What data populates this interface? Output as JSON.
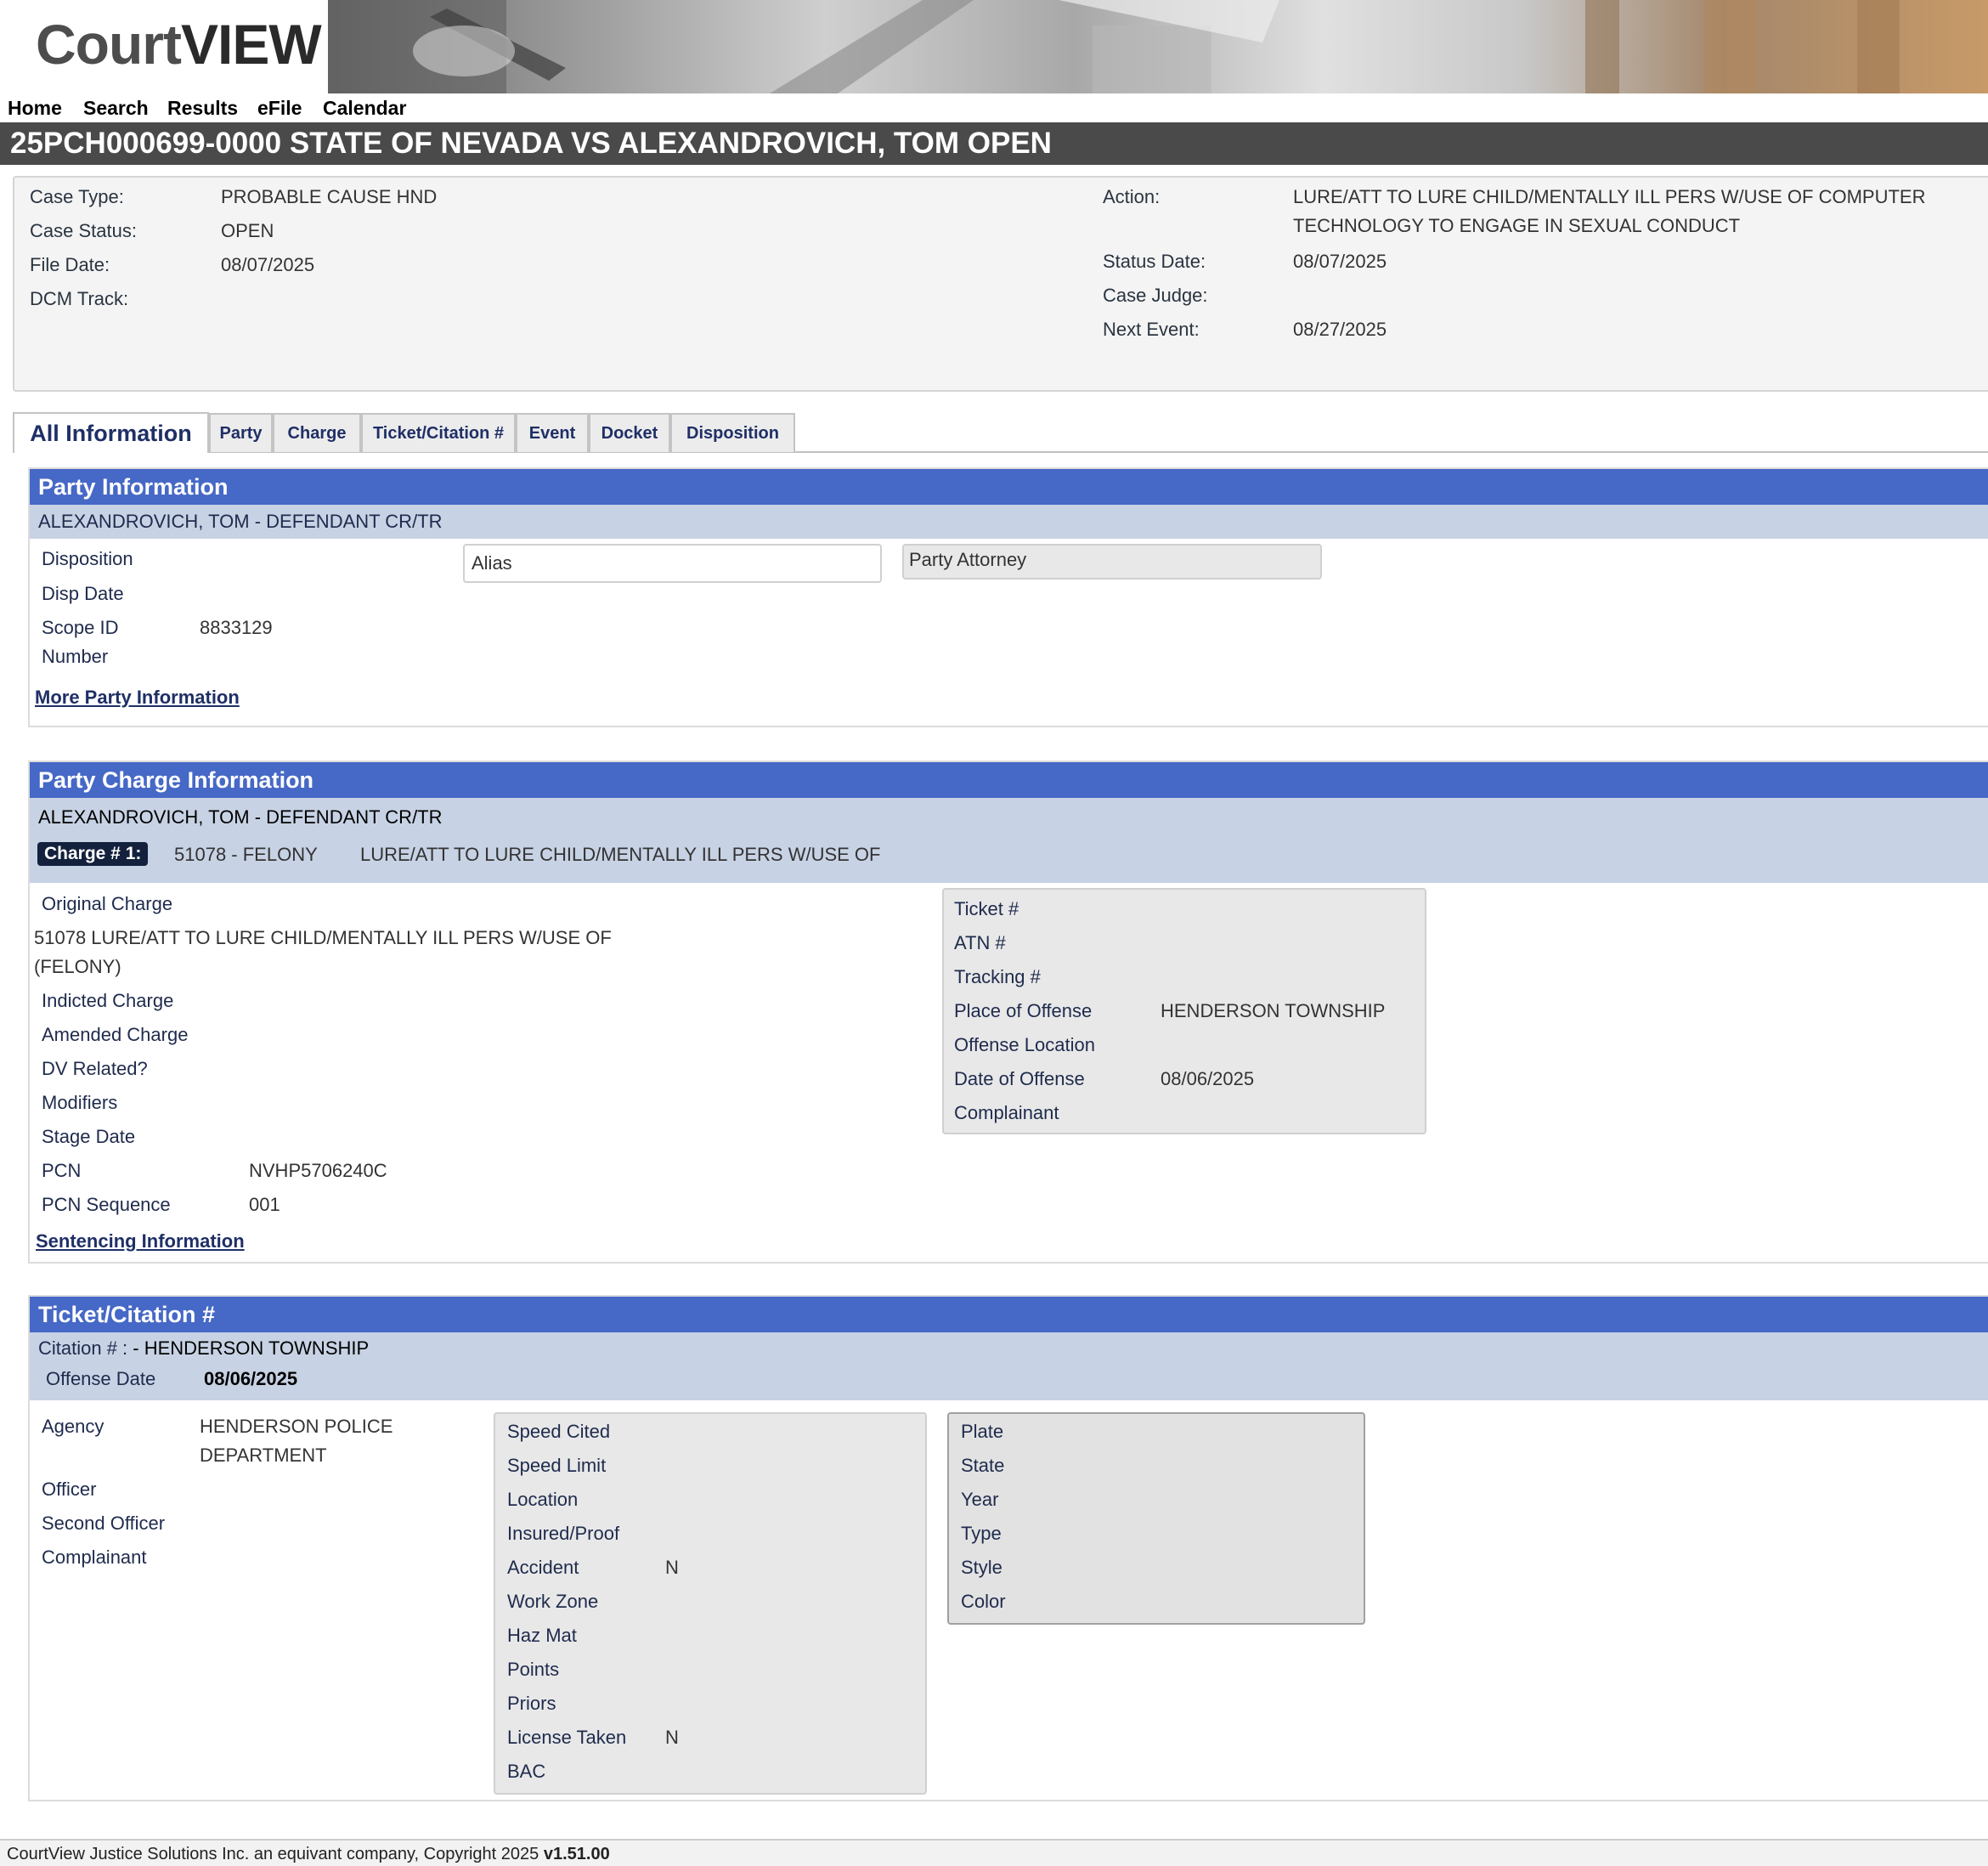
{
  "app": {
    "logo_court": "Court",
    "logo_view": "VIEW"
  },
  "nav": {
    "home": "Home",
    "search": "Search",
    "results": "Results",
    "efile": "eFile",
    "calendar": "Calendar"
  },
  "case": {
    "title": "25PCH000699-0000 STATE OF NEVADA VS ALEXANDROVICH, TOM OPEN"
  },
  "summary": {
    "case_type_label": "Case Type:",
    "case_type": "PROBABLE CAUSE HND",
    "case_status_label": "Case Status:",
    "case_status": "OPEN",
    "file_date_label": "File Date:",
    "file_date": "08/07/2025",
    "dcm_track_label": "DCM Track:",
    "action_label": "Action:",
    "action_line1": "LURE/ATT TO LURE CHILD/MENTALLY ILL PERS W/USE OF COMPUTER",
    "action_line2": "TECHNOLOGY TO ENGAGE IN SEXUAL CONDUCT",
    "status_date_label": "Status Date:",
    "status_date": "08/07/2025",
    "case_judge_label": "Case Judge:",
    "next_event_label": "Next Event:",
    "next_event": "08/27/2025"
  },
  "tabs": {
    "all": "All Information",
    "party": "Party",
    "charge": "Charge",
    "ticket": "Ticket/Citation #",
    "event": "Event",
    "docket": "Docket",
    "disposition": "Disposition"
  },
  "party_info": {
    "heading": "Party Information",
    "party_name": "ALEXANDROVICH, TOM",
    "party_role": " - DEFENDANT CR/TR",
    "disposition_label": "Disposition",
    "disp_date_label": "Disp Date",
    "scope_id_label_1": "Scope ID",
    "scope_id_label_2": "Number",
    "scope_id": "8833129",
    "alias_label": "Alias",
    "attorney_label": "Party Attorney",
    "more_link": "More Party Information"
  },
  "charge_info": {
    "heading": "Party Charge Information",
    "party_name": "ALEXANDROVICH, TOM",
    "party_role": " - DEFENDANT CR/TR",
    "charge_badge": "Charge # 1:",
    "charge_code": "51078 - FELONY",
    "charge_desc": "LURE/ATT TO LURE CHILD/MENTALLY ILL PERS W/USE OF",
    "original_charge_label": "Original Charge",
    "original_charge_line1": "51078 LURE/ATT TO LURE CHILD/MENTALLY ILL PERS W/USE OF",
    "original_charge_line2": "(FELONY)",
    "indicted_label": "Indicted Charge",
    "amended_label": "Amended Charge",
    "dv_label": "DV Related?",
    "modifiers_label": "Modifiers",
    "stage_date_label": "Stage Date",
    "pcn_label": "PCN",
    "pcn": "NVHP5706240C",
    "pcn_seq_label": "PCN Sequence",
    "pcn_seq": "001",
    "sentencing_link": "Sentencing Information",
    "ticket_label": "Ticket #",
    "atn_label": "ATN #",
    "tracking_label": "Tracking #",
    "place_label": "Place of Offense",
    "place": "HENDERSON TOWNSHIP",
    "location_label": "Offense Location",
    "date_label": "Date of Offense",
    "date": "08/06/2025",
    "complainant_label": "Complainant"
  },
  "citation": {
    "heading": "Ticket/Citation #",
    "citation_label": "Citation # : ",
    "citation_place": "- HENDERSON TOWNSHIP",
    "offense_date_label": "Offense Date",
    "offense_date": "08/06/2025",
    "agency_label": "Agency",
    "agency_line1": "HENDERSON POLICE",
    "agency_line2": "DEPARTMENT",
    "officer_label": "Officer",
    "second_officer_label": "Second Officer",
    "complainant_label": "Complainant",
    "speed_cited_label": "Speed Cited",
    "speed_limit_label": "Speed Limit",
    "location_label": "Location",
    "insured_label": "Insured/Proof",
    "accident_label": "Accident",
    "accident": "N",
    "work_zone_label": "Work Zone",
    "haz_mat_label": "Haz Mat",
    "points_label": "Points",
    "priors_label": "Priors",
    "license_label": "License Taken",
    "license": "N",
    "bac_label": "BAC",
    "plate_label": "Plate",
    "state_label": "State",
    "year_label": "Year",
    "type_label": "Type",
    "style_label": "Style",
    "color_label": "Color"
  },
  "footer": {
    "text": "CourtView Justice Solutions Inc. an equivant company, Copyright 2025 ",
    "version": "v1.51.00"
  }
}
